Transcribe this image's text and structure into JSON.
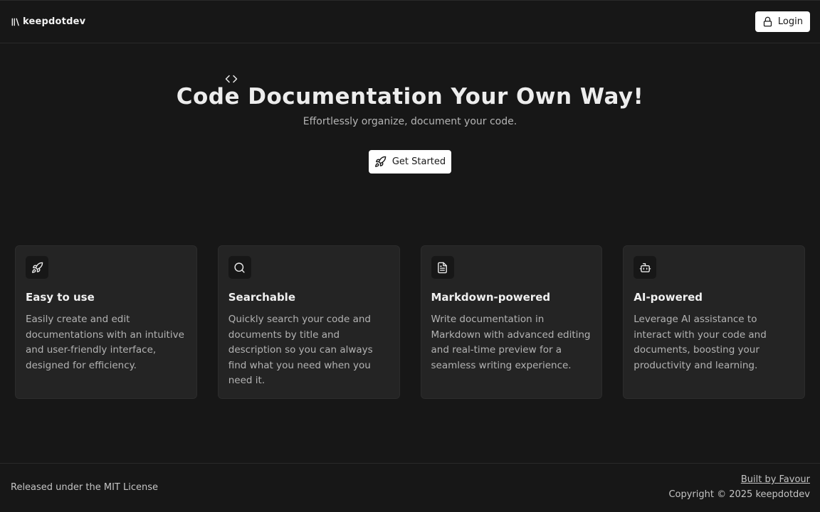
{
  "header": {
    "brand": "keepdotdev",
    "brand_icon": "library-icon",
    "login_label": "Login",
    "login_icon": "lock-icon"
  },
  "hero": {
    "icon": "code-icon",
    "title": "Code Documentation Your Own Way!",
    "subtitle": "Effortlessly organize, document your code.",
    "cta_label": "Get Started",
    "cta_icon": "rocket-icon"
  },
  "features": [
    {
      "icon": "rocket-icon",
      "title": "Easy to use",
      "description": "Easily create and edit documentations with an intuitive and user-friendly interface, designed for efficiency."
    },
    {
      "icon": "search-icon",
      "title": "Searchable",
      "description": "Quickly search your code and documents by title and description so you can always find what you need when you need it."
    },
    {
      "icon": "file-text-icon",
      "title": "Markdown-powered",
      "description": "Write documentation in Markdown with advanced editing and real-time preview for a seamless writing experience."
    },
    {
      "icon": "bot-icon",
      "title": "AI-powered",
      "description": "Leverage AI assistance to interact with your code and documents, boosting your productivity and learning."
    }
  ],
  "footer": {
    "license": "Released under the MIT License",
    "built_by": "Built by Favour",
    "copyright": "Copyright © 2025 keepdotdev"
  },
  "colors": {
    "background": "#171717",
    "card_background": "#242424",
    "button_background": "#ffffff",
    "text_primary": "#ededed",
    "text_muted": "#b3b3b3"
  }
}
